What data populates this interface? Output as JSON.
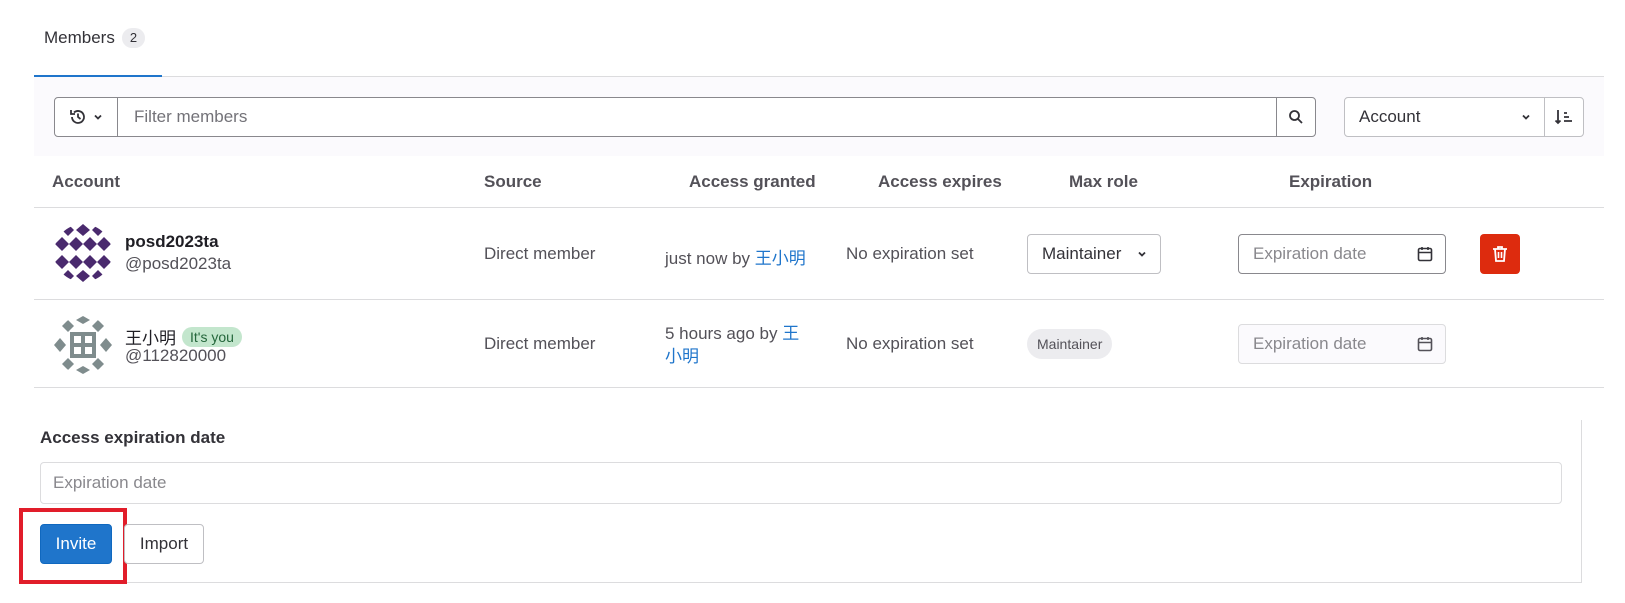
{
  "tabs": [
    {
      "label": "Members",
      "count": "2"
    }
  ],
  "filter": {
    "placeholder": "Filter members",
    "sort_field": "Account"
  },
  "table": {
    "headers": {
      "account": "Account",
      "source": "Source",
      "access_granted": "Access granted",
      "access_expires": "Access expires",
      "max_role": "Max role",
      "expiration": "Expiration"
    },
    "rows": [
      {
        "name": "posd2023ta",
        "handle": "@posd2023ta",
        "source": "Direct member",
        "granted_prefix": "just now by",
        "granted_by": "王小明",
        "expires": "No expiration set",
        "role": "Maintainer",
        "expiration_placeholder": "Expiration date"
      },
      {
        "name": "王小明",
        "badge": "It's you",
        "handle": "@112820000",
        "source": "Direct member",
        "granted_prefix": "5 hours ago by",
        "granted_by_line1": "王",
        "granted_by_line2": "小明",
        "expires": "No expiration set",
        "role": "Maintainer",
        "expiration_placeholder": "Expiration date"
      }
    ]
  },
  "invite": {
    "label": "Access expiration date",
    "date_placeholder": "Expiration date",
    "invite_label": "Invite",
    "import_label": "Import"
  },
  "colors": {
    "primary": "#1f75cb",
    "danger": "#dd2b0e",
    "highlight": "#e11d2a",
    "you_badge": "#c3e6cd"
  }
}
